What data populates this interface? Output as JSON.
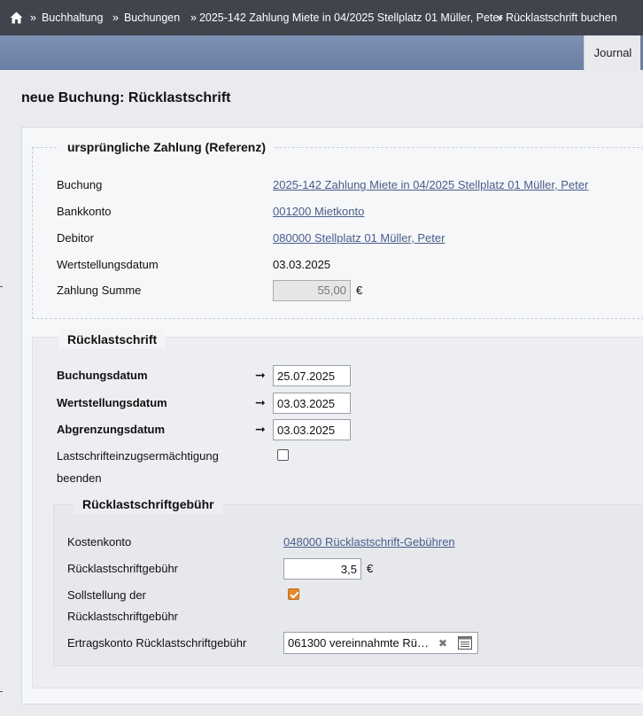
{
  "breadcrumb": {
    "separator": "»",
    "items": [
      "Buchhaltung",
      "Buchungen",
      "2025-142 Zahlung Miete in 04/2025 Stellplatz 01 Müller, Peter",
      "Rücklastschrift buchen"
    ]
  },
  "tabs": {
    "journal": "Journal"
  },
  "page": {
    "title": "neue Buchung: Rücklastschrift"
  },
  "reference": {
    "legend": "ursprüngliche Zahlung (Referenz)",
    "buchung_label": "Buchung",
    "buchung_value": "2025-142 Zahlung Miete in 04/2025 Stellplatz 01 Müller, Peter",
    "bankkonto_label": "Bankkonto",
    "bankkonto_value": "001200 Mietkonto",
    "debitor_label": "Debitor",
    "debitor_value": "080000 Stellplatz 01 Müller, Peter",
    "wertstellung_label": "Wertstellungsdatum",
    "wertstellung_value": "03.03.2025",
    "summe_label": "Zahlung Summe",
    "summe_value": "55,00",
    "currency": "€"
  },
  "ruecklast": {
    "legend": "Rücklastschrift",
    "buchungsdatum_label": "Buchungsdatum",
    "buchungsdatum_value": "25.07.2025",
    "wertstellungsdatum_label": "Wertstellungsdatum",
    "wertstellungsdatum_value": "03.03.2025",
    "abgrenzungsdatum_label": "Abgrenzungsdatum",
    "abgrenzungsdatum_value": "03.03.2025",
    "arrow": "➞",
    "mandat_label_1": "Lastschrifteinzugsermächtigung",
    "mandat_label_2": "beenden",
    "mandat_checked": false
  },
  "gebuehr": {
    "legend": "Rücklastschriftgebühr",
    "kostenkonto_label": "Kostenkonto",
    "kostenkonto_value": "048000 Rücklastschrift-Gebühren",
    "gebuehr_label": "Rücklastschriftgebühr",
    "gebuehr_value": "3,5",
    "currency": "€",
    "sollstellung_label_1": "Sollstellung der",
    "sollstellung_label_2": "Rücklastschriftgebühr",
    "sollstellung_checked": true,
    "ertragskonto_label": "Ertragskonto Rücklastschriftgebühr",
    "ertragskonto_value": "061300 vereinnahmte Rü…",
    "clear_symbol": "✖"
  },
  "colors": {
    "accent": "#e38a2c",
    "link": "#4a5d8a",
    "topbar": "#3f444d",
    "bluebar": "#7488ac"
  }
}
